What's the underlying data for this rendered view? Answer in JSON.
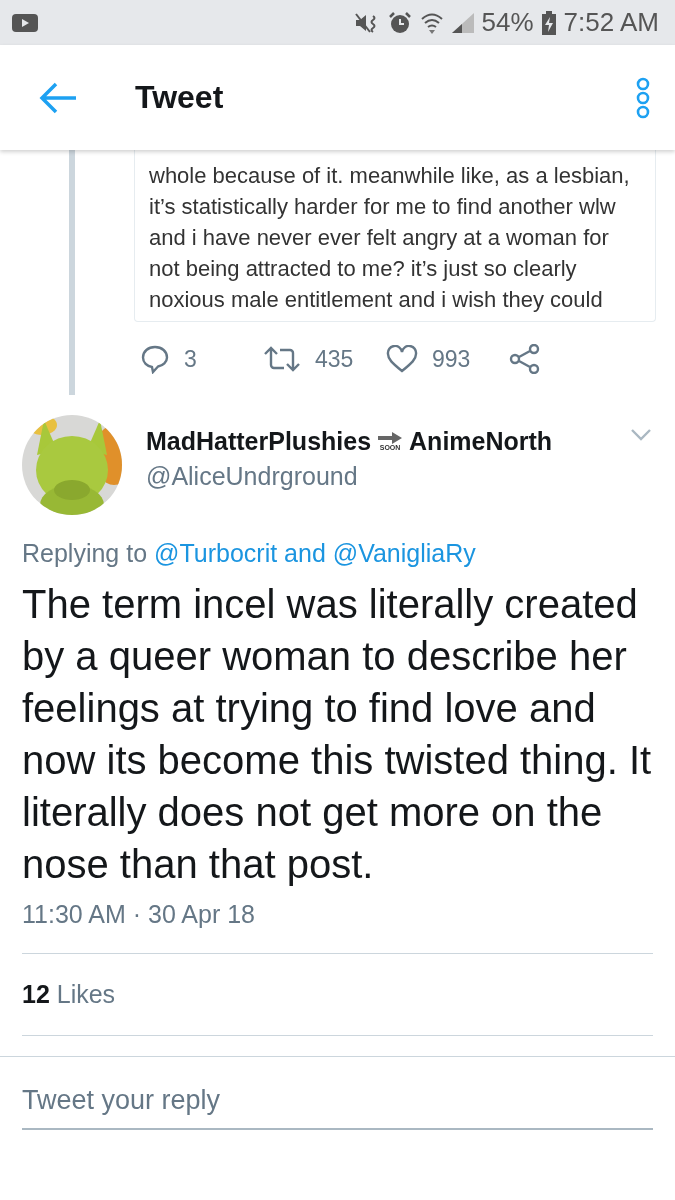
{
  "status_bar": {
    "battery": "54%",
    "time": "7:52 AM"
  },
  "header": {
    "title": "Tweet"
  },
  "quoted_tweet": {
    "text": "whole because of it. meanwhile like, as a lesbian, it’s statistically harder for me to find another wlw and i have never ever felt angry at a woman for not being attracted to me? it’s just so clearly noxious male entitlement and i wish they could",
    "actions": [
      {
        "kind": "reply",
        "count": "3"
      },
      {
        "kind": "retweet",
        "count": "435"
      },
      {
        "kind": "like",
        "count": "993"
      },
      {
        "kind": "share"
      }
    ]
  },
  "tweet": {
    "author": {
      "name_parts": [
        "MadHatterPlushies",
        "AnimeNorth"
      ],
      "emoji_label": "SOON",
      "handle": "@AliceUndrground"
    },
    "replying_to": {
      "label": "Replying to",
      "mentions": "@Turbocrit and @VanigliaRy"
    },
    "text": "The term incel was literally created by a queer woman to describe her feelings at trying to find love and now its become this twisted thing. It literally does not get more on the nose than that post.",
    "timestamp": "11:30 AM · 30 Apr 18",
    "likes": "**12** Likes"
  },
  "reply_field": {
    "placeholder": "Tweet your reply"
  }
}
